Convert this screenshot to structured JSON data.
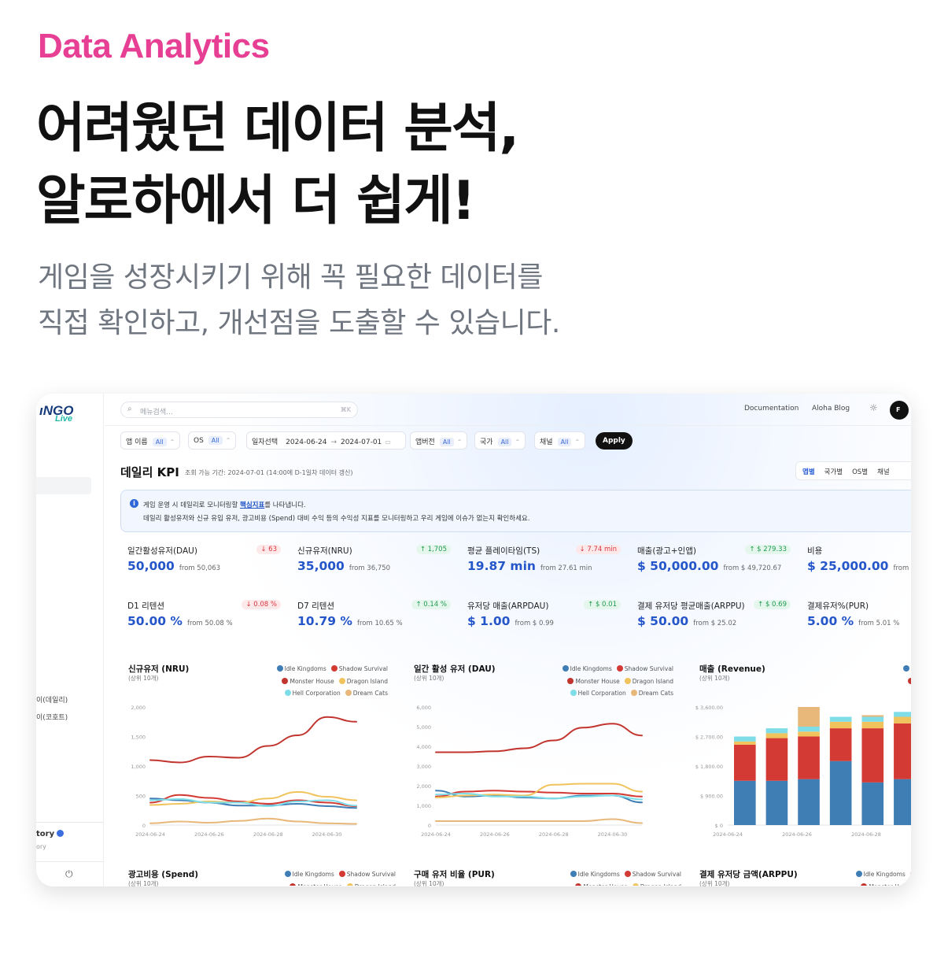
{
  "hero": {
    "eyebrow": "Data Analytics",
    "headline_line1": "어려웠던 데이터 분석,",
    "headline_line2": "알로하에서 더 쉽게!",
    "sub_line1": "게임을 성장시키기 위해 꼭 필요한 데이터를",
    "sub_line2": "직접 확인하고, 개선점을 도출할 수 있습니다."
  },
  "app": {
    "logo_main": "ıNGO",
    "logo_sub": "Live",
    "sidebar_items": [
      "이(데일리)",
      "이(코호트)"
    ],
    "sidebar_footer_title": "tory",
    "sidebar_footer_sub": "ory",
    "search_placeholder": "메뉴검색...",
    "search_shortcut": "⌘K",
    "top_links": [
      "Documentation",
      "Aloha Blog"
    ],
    "avatar_initial": "F"
  },
  "filters": [
    {
      "label": "앱 이름",
      "value": "All"
    },
    {
      "label": "OS",
      "value": "All"
    },
    {
      "label": "일자선택",
      "start": "2024-06-24",
      "end": "2024-07-01"
    },
    {
      "label": "앱버전",
      "value": "All"
    },
    {
      "label": "국가",
      "value": "All"
    },
    {
      "label": "채널",
      "value": "All"
    }
  ],
  "apply_label": "Apply",
  "page": {
    "title": "데일리 KPI",
    "note": "조회 가능 기간: 2024-07-01 (14:00에 D-1일차 데이터 갱신)",
    "tabs": [
      "앱별",
      "국가별",
      "OS별",
      "채널"
    ]
  },
  "info": {
    "line1_a": "게임 운영 시 데일리로 모니터링할 ",
    "line1_b": "핵심지표",
    "line1_c": "를 나타냅니다.",
    "line2": "데일리 활성유저와 신규 유입 유저, 광고비용 (Spend) 대비 수익 등의 수익성 지표를 모니터링하고 우리 게임에 이슈가 없는지 확인하세요."
  },
  "kpis": [
    {
      "label": "일간활성유저(DAU)",
      "badge": "↓ 63",
      "dir": "down",
      "value": "50,000",
      "from": "from 50,063"
    },
    {
      "label": "신규유저(NRU)",
      "badge": "↑ 1,705",
      "dir": "up",
      "value": "35,000",
      "from": "from 36,750"
    },
    {
      "label": "평균 플레이타임(TS)",
      "badge": "↓ 7.74 min",
      "dir": "down",
      "value": "19.87 min",
      "from": "from 27.61 min"
    },
    {
      "label": "매출(광고+인앱)",
      "badge": "↑ $ 279.33",
      "dir": "up",
      "value": "$ 50,000.00",
      "from": "from $ 49,720.67"
    },
    {
      "label": "비용",
      "badge": "↑",
      "dir": "down",
      "value": "$ 25,000.00",
      "from": "from $ 2"
    },
    {
      "label": "D1 리텐션",
      "badge": "↓ 0.08 %",
      "dir": "down",
      "value": "50.00 %",
      "from": "from 50.08 %"
    },
    {
      "label": "D7 리텐션",
      "badge": "↑ 0.14 %",
      "dir": "up",
      "value": "10.79 %",
      "from": "from 10.65 %"
    },
    {
      "label": "유저당 매출(ARPDAU)",
      "badge": "↑ $ 0.01",
      "dir": "up",
      "value": "$ 1.00",
      "from": "from $ 0.99"
    },
    {
      "label": "결제 유저당 평균매출(ARPPU)",
      "badge": "↑ $ 0.69",
      "dir": "up",
      "value": "$ 50.00",
      "from": "from $ 25.02"
    },
    {
      "label": "결제유저%(PUR)",
      "badge": "",
      "dir": "up",
      "value": "5.00 %",
      "from": "from 5.01 %"
    }
  ],
  "legend_series": [
    {
      "name": "Idle Kingdoms",
      "color": "#3f7eb5"
    },
    {
      "name": "Shadow Survival",
      "color": "#d43a34"
    },
    {
      "name": "Monster House",
      "color": "#c2352f"
    },
    {
      "name": "Dragon Island",
      "color": "#f0c35d"
    },
    {
      "name": "Hell Corporation",
      "color": "#7fdde8"
    },
    {
      "name": "Dream Cats",
      "color": "#e8b77a"
    }
  ],
  "chart_data": [
    {
      "type": "line",
      "title": "신규유저 (NRU)",
      "subtitle": "(상위 10개)",
      "x_ticks": [
        "2024-06-24",
        "2024-06-26",
        "2024-06-28",
        "2024-06-30"
      ],
      "y_ticks": [
        "0",
        "500",
        "1,000",
        "1,500",
        "2,000"
      ],
      "ylim": [
        0,
        2000
      ],
      "x": [
        0,
        1,
        2,
        3,
        4,
        5,
        6,
        7
      ],
      "series": [
        {
          "name": "Monster House",
          "values": [
            1100,
            1060,
            1160,
            1140,
            1340,
            1520,
            1830,
            1750
          ]
        },
        {
          "name": "Idle Kingdoms",
          "values": [
            450,
            420,
            380,
            330,
            330,
            360,
            320,
            290
          ]
        },
        {
          "name": "Shadow Survival",
          "values": [
            380,
            510,
            460,
            400,
            360,
            420,
            380,
            320
          ]
        },
        {
          "name": "Dragon Island",
          "values": [
            340,
            360,
            400,
            380,
            450,
            560,
            480,
            420
          ]
        },
        {
          "name": "Hell Corporation",
          "values": [
            420,
            440,
            380,
            380,
            320,
            400,
            420,
            330
          ]
        },
        {
          "name": "Dream Cats",
          "values": [
            30,
            60,
            40,
            70,
            110,
            60,
            30,
            20
          ]
        }
      ]
    },
    {
      "type": "line",
      "title": "일간 활성 유저 (DAU)",
      "subtitle": "(상위 10개)",
      "x_ticks": [
        "2024-06-24",
        "2024-06-26",
        "2024-06-28",
        "2024-06-30"
      ],
      "y_ticks": [
        "0",
        "1,000",
        "2,000",
        "3,000",
        "4,000",
        "5,000",
        "6,000"
      ],
      "ylim": [
        0,
        6000
      ],
      "x": [
        0,
        1,
        2,
        3,
        4,
        5,
        6,
        7
      ],
      "series": [
        {
          "name": "Monster House",
          "values": [
            3700,
            3700,
            3750,
            3900,
            4300,
            4950,
            5150,
            4550
          ]
        },
        {
          "name": "Idle Kingdoms",
          "values": [
            1750,
            1450,
            1500,
            1400,
            1350,
            1500,
            1500,
            1150
          ]
        },
        {
          "name": "Shadow Survival",
          "values": [
            1450,
            1700,
            1750,
            1700,
            1650,
            1600,
            1600,
            1450
          ]
        },
        {
          "name": "Dragon Island",
          "values": [
            1400,
            1500,
            1550,
            1500,
            2050,
            2100,
            2100,
            1700
          ]
        },
        {
          "name": "Hell Corporation",
          "values": [
            1550,
            1600,
            1450,
            1450,
            1350,
            1450,
            1500,
            1300
          ]
        },
        {
          "name": "Dream Cats",
          "values": [
            200,
            200,
            200,
            200,
            200,
            200,
            300,
            100
          ]
        }
      ]
    },
    {
      "type": "bar",
      "title": "매출 (Revenue)",
      "subtitle": "(상위 10개)",
      "stacked": true,
      "x_ticks": [
        "2024-06-24",
        "2024-06-26",
        "2024-06-28",
        "2024"
      ],
      "y_ticks": [
        "$ 0",
        "$ 900.00",
        "$ 1,800.00",
        "$ 2,700.00",
        "$ 3,600.00"
      ],
      "ylim": [
        0,
        3600
      ],
      "categories": [
        "2024-06-24",
        "2024-06-25",
        "2024-06-26",
        "2024-06-27",
        "2024-06-28",
        "2024-06-29",
        "2024-06-30"
      ],
      "series": [
        {
          "name": "Idle Kingdoms",
          "values": [
            1350,
            1350,
            1400,
            1950,
            1300,
            1400,
            1050
          ]
        },
        {
          "name": "Shadow Survival",
          "values": [
            1100,
            1300,
            1300,
            1000,
            1650,
            1700,
            1600
          ]
        },
        {
          "name": "Dragon Island",
          "values": [
            100,
            150,
            150,
            200,
            200,
            200,
            200
          ]
        },
        {
          "name": "Hell Corporation",
          "values": [
            150,
            150,
            150,
            150,
            150,
            150,
            150
          ]
        },
        {
          "name": "Dream Cats",
          "values": [
            0,
            0,
            600,
            0,
            50,
            0,
            0
          ]
        }
      ]
    }
  ],
  "next_row": [
    {
      "title": "광고비용 (Spend)",
      "subtitle": "(상위 10개)"
    },
    {
      "title": "구매 유저 비율 (PUR)",
      "subtitle": "(상위 10개)"
    },
    {
      "title": "결제 유저당 금액(ARPPU)",
      "subtitle": "(상위 10개)"
    }
  ]
}
